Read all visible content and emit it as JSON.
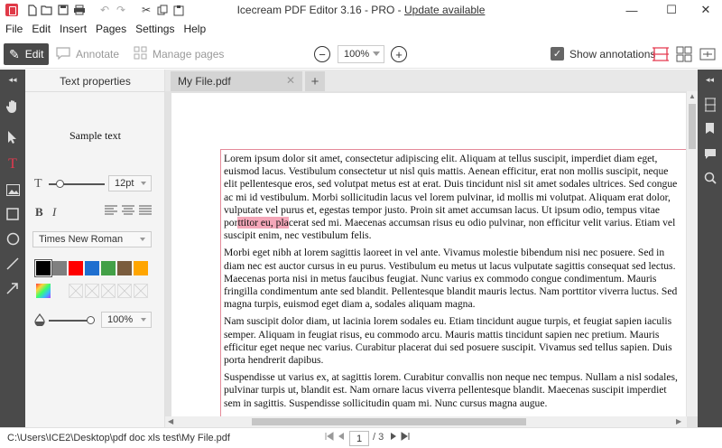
{
  "window": {
    "title": "Icecream PDF Editor 3.16 - PRO - ",
    "update_link": "Update available",
    "minimize": "—",
    "maximize": "☐",
    "close": "✕"
  },
  "quick_access": [
    "new-icon",
    "open-icon",
    "save-icon",
    "print-icon",
    "undo-icon",
    "redo-icon",
    "cut-icon",
    "paste-icon"
  ],
  "menu": {
    "items": [
      "File",
      "Edit",
      "Insert",
      "Pages",
      "Settings",
      "Help"
    ]
  },
  "toolbar": {
    "modes": [
      {
        "label": "Edit",
        "icon": "pencil-icon",
        "active": true
      },
      {
        "label": "Annotate",
        "icon": "comment-icon",
        "active": false
      },
      {
        "label": "Manage pages",
        "icon": "grid-icon",
        "active": false
      }
    ],
    "zoom": "100%",
    "zoom_out": "−",
    "zoom_in": "+",
    "show_annotations_label": "Show annotations",
    "show_annotations_checked": true
  },
  "left_tools": [
    "collapse-icon",
    "hand-icon",
    "select-arrow-icon",
    "text-tool-icon",
    "image-icon",
    "rectangle-icon",
    "ellipse-icon",
    "line-icon",
    "arrow-icon"
  ],
  "properties": {
    "header": "Text properties",
    "sample": "Sample text",
    "font_size": "12pt",
    "font_family": "Times New Roman",
    "bold": "B",
    "italic": "I",
    "opacity": "100%",
    "colors": [
      "#000000",
      "#7f7f7f",
      "#ff0000",
      "#1f6fcf",
      "#43a047",
      "#7a5c3e",
      "#ffa500"
    ]
  },
  "tabs": [
    {
      "label": "My File.pdf",
      "close": "✕"
    }
  ],
  "tab_add": "+",
  "document": {
    "paragraphs": [
      {
        "before": "Lorem ipsum dolor sit amet, consectetur adipiscing elit. Aliquam at tellus suscipit, imperdiet diam eget, euismod lacus. Vestibulum consectetur ut nisl quis mattis. Aenean efficitur, erat non mollis suscipit, neque elit pellentesque eros, sed volutpat metus est at erat. Duis tincidunt nisl sit amet sodales ultrices. Sed congue ac mi id vestibulum. Morbi sollicitudin lacus vel lorem pulvinar, id mollis mi volutpat. Aliquam erat dolor, vulputate vel purus et, egestas tempor justo. Proin sit amet accumsan lacus. Ut ipsum odio, tempus vitae por",
        "highlight": "ttitor eu, pla",
        "after": "cerat sed mi. Maecenas accumsan risus eu odio pulvinar, non efficitur velit varius. Etiam vel suscipit enim, nec vestibulum felis."
      },
      {
        "text": "Morbi eget nibh at lorem sagittis laoreet in vel ante. Vivamus molestie bibendum nisi nec posuere. Sed in diam nec est auctor cursus in eu purus. Vestibulum eu metus ut lacus vulputate sagittis consequat sed lectus. Maecenas porta nisi in metus faucibus feugiat. Nunc varius ex commodo congue condimentum. Mauris fringilla condimentum ante sed blandit. Pellentesque blandit mauris lectus. Nam porttitor viverra luctus. Sed magna turpis, euismod eget diam a, sodales aliquam magna."
      },
      {
        "text": "Nam suscipit dolor diam, ut lacinia lorem sodales eu. Etiam tincidunt augue turpis, et feugiat sapien iaculis semper. Aliquam in feugiat risus, eu commodo arcu. Mauris mattis tincidunt sapien nec pretium. Mauris efficitur eget neque nec varius. Curabitur placerat dui sed posuere suscipit. Vivamus sed tellus sapien. Duis porta hendrerit dapibus."
      },
      {
        "text": "Suspendisse ut varius ex, at sagittis lorem. Curabitur convallis non neque nec tempus. Nullam a nisl sodales, pulvinar turpis ut, blandit est. Nam ornare lacus viverra pellentesque blandit. Maecenas suscipit imperdiet sem in sagittis. Suspendisse sollicitudin quam mi. Nunc cursus magna augue."
      }
    ]
  },
  "right_tools": [
    "collapse-icon",
    "page-layout-icon",
    "bookmark-icon",
    "comments-icon",
    "search-icon"
  ],
  "status": {
    "path": "C:\\Users\\ICE2\\Desktop\\pdf doc xls test\\My File.pdf",
    "current_page": "1",
    "total_pages": "/ 3"
  }
}
